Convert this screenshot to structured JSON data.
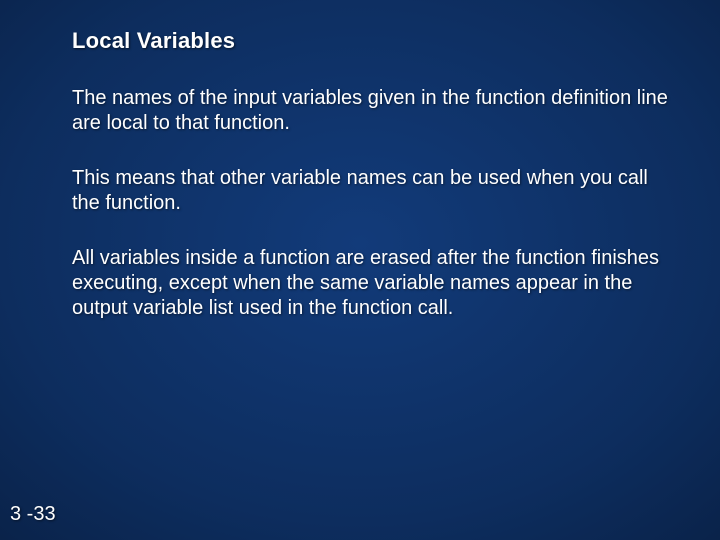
{
  "slide": {
    "title": "Local Variables",
    "paragraphs": [
      "The names of the input variables given in the function definition line are local to that function.",
      "This means that other variable names can be used when you call the function.",
      "All variables inside a function are erased after the function finishes executing, except when the same variable names appear in the output variable list used in the function call."
    ],
    "page_number": "3 -33"
  }
}
